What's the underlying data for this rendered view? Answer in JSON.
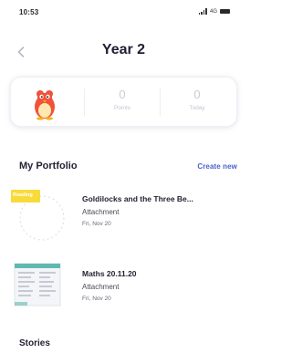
{
  "status_bar": {
    "time": "10:53",
    "network": "4G"
  },
  "header": {
    "title": "Year 2"
  },
  "stats": {
    "points_value": "0",
    "points_label": "Points",
    "today_value": "0",
    "today_label": "Today"
  },
  "portfolio": {
    "section_title": "My Portfolio",
    "create_label": "Create new",
    "items": [
      {
        "title": "Goldilocks and the Three Be...",
        "type": "Attachment",
        "date": "Fri, Nov 20",
        "tag": "Reading"
      },
      {
        "title": "Maths 20.11.20",
        "type": "Attachment",
        "date": "Fri, Nov 20"
      }
    ]
  },
  "stories": {
    "section_title": "Stories"
  },
  "colors": {
    "accent": "#4a63c9",
    "avatar_body": "#f0523a",
    "avatar_belly": "#fde8b0",
    "tag": "#f8db3a"
  }
}
